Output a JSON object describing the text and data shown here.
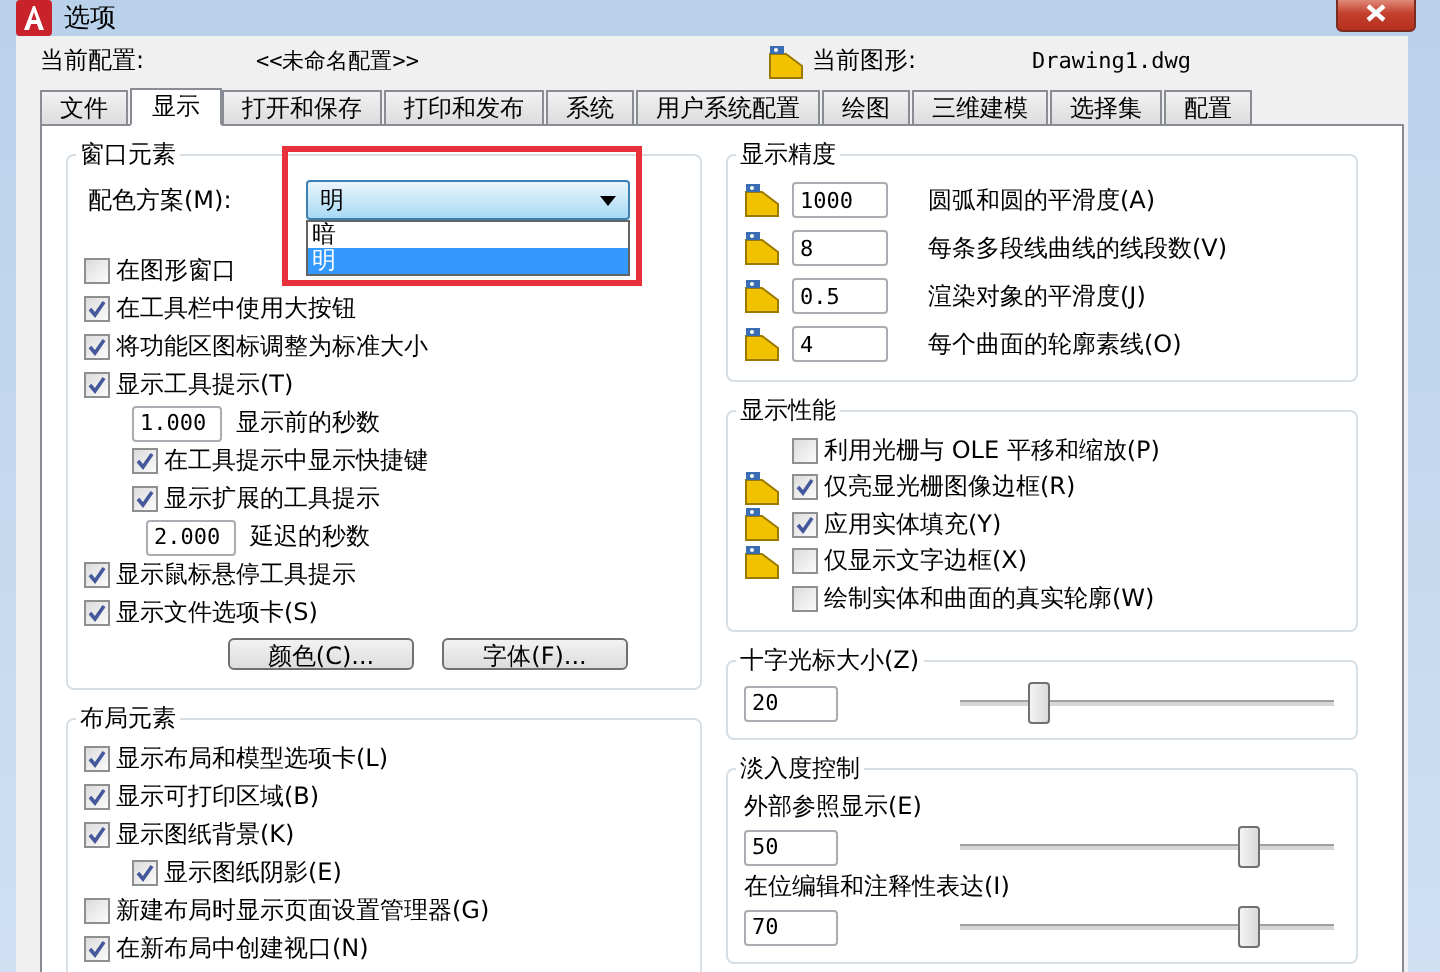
{
  "window": {
    "title": "选项"
  },
  "profile": {
    "label": "当前配置:",
    "value": "<<未命名配置>>"
  },
  "drawing": {
    "label": "当前图形:",
    "value": "Drawing1.dwg"
  },
  "tabs": [
    {
      "label": "文件",
      "selected": false
    },
    {
      "label": "显示",
      "selected": true
    },
    {
      "label": "打开和保存",
      "selected": false
    },
    {
      "label": "打印和发布",
      "selected": false
    },
    {
      "label": "系统",
      "selected": false
    },
    {
      "label": "用户系统配置",
      "selected": false
    },
    {
      "label": "绘图",
      "selected": false
    },
    {
      "label": "三维建模",
      "selected": false
    },
    {
      "label": "选择集",
      "selected": false
    },
    {
      "label": "配置",
      "selected": false
    }
  ],
  "window_elements": {
    "title": "窗口元素",
    "color_scheme": {
      "label": "配色方案(M):",
      "value": "明",
      "expanded": true,
      "options": [
        {
          "label": "暗",
          "selected": false
        },
        {
          "label": "明",
          "selected": true
        }
      ]
    },
    "items": [
      {
        "kind": "checkbox",
        "label": "在图形窗口",
        "checked": false
      },
      {
        "kind": "checkbox",
        "label": "在工具栏中使用大按钮",
        "checked": true
      },
      {
        "kind": "checkbox",
        "label": "将功能区图标调整为标准大小",
        "checked": true
      },
      {
        "kind": "checkbox",
        "label": "显示工具提示(T)",
        "checked": true,
        "children": [
          {
            "kind": "number",
            "value": "1.000",
            "label": "显示前的秒数"
          },
          {
            "kind": "checkbox",
            "label": "在工具提示中显示快捷键",
            "checked": true
          },
          {
            "kind": "checkbox",
            "label": "显示扩展的工具提示",
            "checked": true,
            "children": [
              {
                "kind": "number",
                "value": "2.000",
                "label": "延迟的秒数"
              }
            ]
          }
        ]
      },
      {
        "kind": "checkbox",
        "label": "显示鼠标悬停工具提示",
        "checked": true
      },
      {
        "kind": "checkbox",
        "label": "显示文件选项卡(S)",
        "checked": true
      }
    ],
    "buttons": [
      "颜色(C)...",
      "字体(F)..."
    ]
  },
  "layout_elements": {
    "title": "布局元素",
    "items": [
      {
        "kind": "checkbox",
        "label": "显示布局和模型选项卡(L)",
        "checked": true
      },
      {
        "kind": "checkbox",
        "label": "显示可打印区域(B)",
        "checked": true
      },
      {
        "kind": "checkbox",
        "label": "显示图纸背景(K)",
        "checked": true,
        "children": [
          {
            "kind": "checkbox",
            "label": "显示图纸阴影(E)",
            "checked": true
          }
        ]
      },
      {
        "kind": "checkbox",
        "label": "新建布局时显示页面设置管理器(G)",
        "checked": false
      },
      {
        "kind": "checkbox",
        "label": "在新布局中创建视口(N)",
        "checked": true
      }
    ]
  },
  "display_resolution": {
    "title": "显示精度",
    "items": [
      {
        "value": "1000",
        "label": "圆弧和圆的平滑度(A)",
        "drawing_icon": true
      },
      {
        "value": "8",
        "label": "每条多段线曲线的线段数(V)",
        "drawing_icon": true
      },
      {
        "value": "0.5",
        "label": "渲染对象的平滑度(J)",
        "drawing_icon": true
      },
      {
        "value": "4",
        "label": "每个曲面的轮廓素线(O)",
        "drawing_icon": true
      }
    ]
  },
  "display_performance": {
    "title": "显示性能",
    "items": [
      {
        "label": "利用光栅与 OLE 平移和缩放(P)",
        "checked": false,
        "drawing_icon": false
      },
      {
        "label": "仅亮显光栅图像边框(R)",
        "checked": true,
        "drawing_icon": true
      },
      {
        "label": "应用实体填充(Y)",
        "checked": true,
        "drawing_icon": true
      },
      {
        "label": "仅显示文字边框(X)",
        "checked": false,
        "drawing_icon": true
      },
      {
        "label": "绘制实体和曲面的真实轮廓(W)",
        "checked": false,
        "drawing_icon": false
      }
    ]
  },
  "crosshair_size": {
    "title": "十字光标大小(Z)",
    "value": "20",
    "level": 0.21
  },
  "fade_control": {
    "title": "淡入度控制",
    "sliders": [
      {
        "label": "外部参照显示(E)",
        "value": "50",
        "level": 0.77
      },
      {
        "label": "在位编辑和注释性表达(I)",
        "value": "70",
        "level": 0.77
      }
    ]
  }
}
